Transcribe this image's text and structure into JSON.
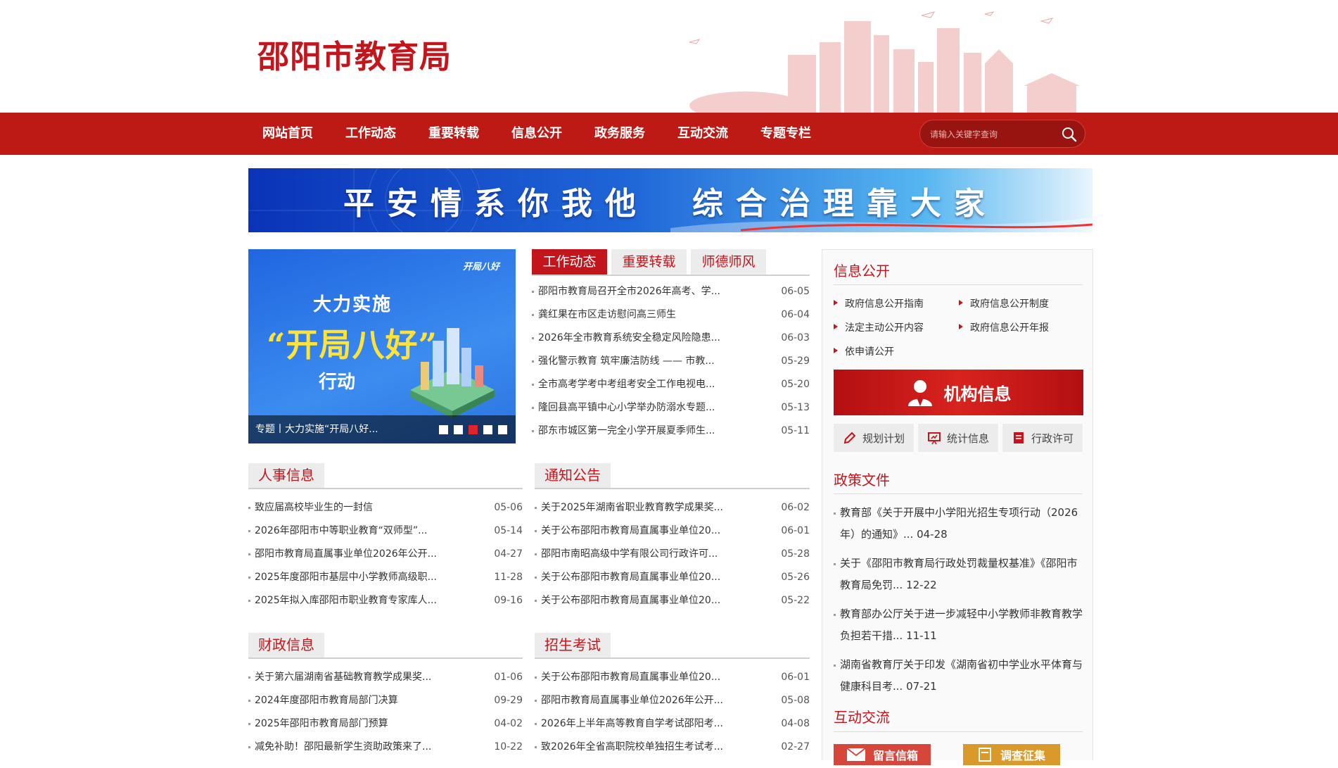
{
  "site": {
    "title": "邵阳市教育局"
  },
  "nav": {
    "items": [
      "网站首页",
      "工作动态",
      "重要转载",
      "信息公开",
      "政务服务",
      "互动交流",
      "专题专栏"
    ],
    "search_placeholder": "请输入关键字查询"
  },
  "banner": {
    "text": "平安情系你我他　综合治理靠大家"
  },
  "carousel": {
    "logo": "开局八好",
    "line1": "大力实施",
    "line2": "“开局八好”",
    "line3": "行动",
    "caption": "专题丨大力实施“开局八好...",
    "active_index": 2,
    "dot_count": 5
  },
  "work_tabs": {
    "tabs": [
      "工作动态",
      "重要转载",
      "师德师风"
    ],
    "active": 0,
    "items": [
      {
        "title": "邵阳市教育局召开全市2026年高考、学...",
        "date": "06-05"
      },
      {
        "title": "龚红果在市区走访慰问高三师生",
        "date": "06-04"
      },
      {
        "title": "2026年全市教育系统安全稳定风险隐患...",
        "date": "06-03"
      },
      {
        "title": "强化警示教育 筑牢廉洁防线 —— 市教...",
        "date": "05-29"
      },
      {
        "title": "全市高考学考中考组考安全工作电视电...",
        "date": "05-20"
      },
      {
        "title": "隆回县高平镇中心小学举办防溺水专题...",
        "date": "05-13"
      },
      {
        "title": "邵东市城区第一完全小学开展夏季师生...",
        "date": "05-11"
      }
    ]
  },
  "personnel": {
    "title": "人事信息",
    "items": [
      {
        "title": "致应届高校毕业生的一封信",
        "date": "05-06"
      },
      {
        "title": "2026年邵阳市中等职业教育“双师型”...",
        "date": "05-14"
      },
      {
        "title": "邵阳市教育局直属事业单位2026年公开...",
        "date": "04-27"
      },
      {
        "title": "2025年度邵阳市基层中小学教师高级职...",
        "date": "11-28"
      },
      {
        "title": "2025年拟入库邵阳市职业教育专家库人...",
        "date": "09-16"
      }
    ]
  },
  "notices": {
    "title": "通知公告",
    "items": [
      {
        "title": "关于2025年湖南省职业教育教学成果奖...",
        "date": "06-02"
      },
      {
        "title": "关于公布邵阳市教育局直属事业单位20...",
        "date": "06-01"
      },
      {
        "title": "邵阳市南昭高级中学有限公司行政许可...",
        "date": "05-28"
      },
      {
        "title": "关于公布邵阳市教育局直属事业单位20...",
        "date": "05-26"
      },
      {
        "title": "关于公布邵阳市教育局直属事业单位20...",
        "date": "05-22"
      }
    ]
  },
  "finance": {
    "title": "财政信息",
    "items": [
      {
        "title": "关于第六届湖南省基础教育教学成果奖...",
        "date": "01-06"
      },
      {
        "title": "2024年度邵阳市教育局部门决算",
        "date": "09-29"
      },
      {
        "title": "2025年邵阳市教育局部门预算",
        "date": "04-02"
      },
      {
        "title": "减免补助！邵阳最新学生资助政策来了...",
        "date": "10-22"
      }
    ]
  },
  "enrollment": {
    "title": "招生考试",
    "items": [
      {
        "title": "关于公布邵阳市教育局直属事业单位20...",
        "date": "06-01"
      },
      {
        "title": "邵阳市教育局直属事业单位2026年公开...",
        "date": "05-08"
      },
      {
        "title": "2026年上半年高等教育自学考试邵阳考...",
        "date": "04-08"
      },
      {
        "title": "致2026年全省高职院校单独招生考试考...",
        "date": "02-27"
      }
    ]
  },
  "info_public": {
    "title": "信息公开",
    "links": [
      "政府信息公开指南",
      "政府信息公开制度",
      "法定主动公开内容",
      "政府信息公开年报",
      "依申请公开"
    ],
    "org_banner": "机构信息",
    "quick": [
      "规划计划",
      "统计信息",
      "行政许可"
    ]
  },
  "policy": {
    "title": "政策文件",
    "items": [
      "教育部《关于开展中小学阳光招生专项行动（2026年）的通知》... 04-28",
      "关于《邵阳市教育局行政处罚裁量权基准》《邵阳市教育局免罚... 12-22",
      "教育部办公厅关于进一步减轻中小学教师非教育教学负担若干措... 11-11",
      "湖南省教育厅关于印发《湖南省初中学业水平体育与健康科目考... 07-21"
    ]
  },
  "interaction": {
    "title": "互动交流",
    "buttons": [
      "留言信箱",
      "调查征集"
    ]
  },
  "colors": {
    "primary": "#bd1a15",
    "accent_red": "#c3151c",
    "tab_bg": "#ececec"
  }
}
